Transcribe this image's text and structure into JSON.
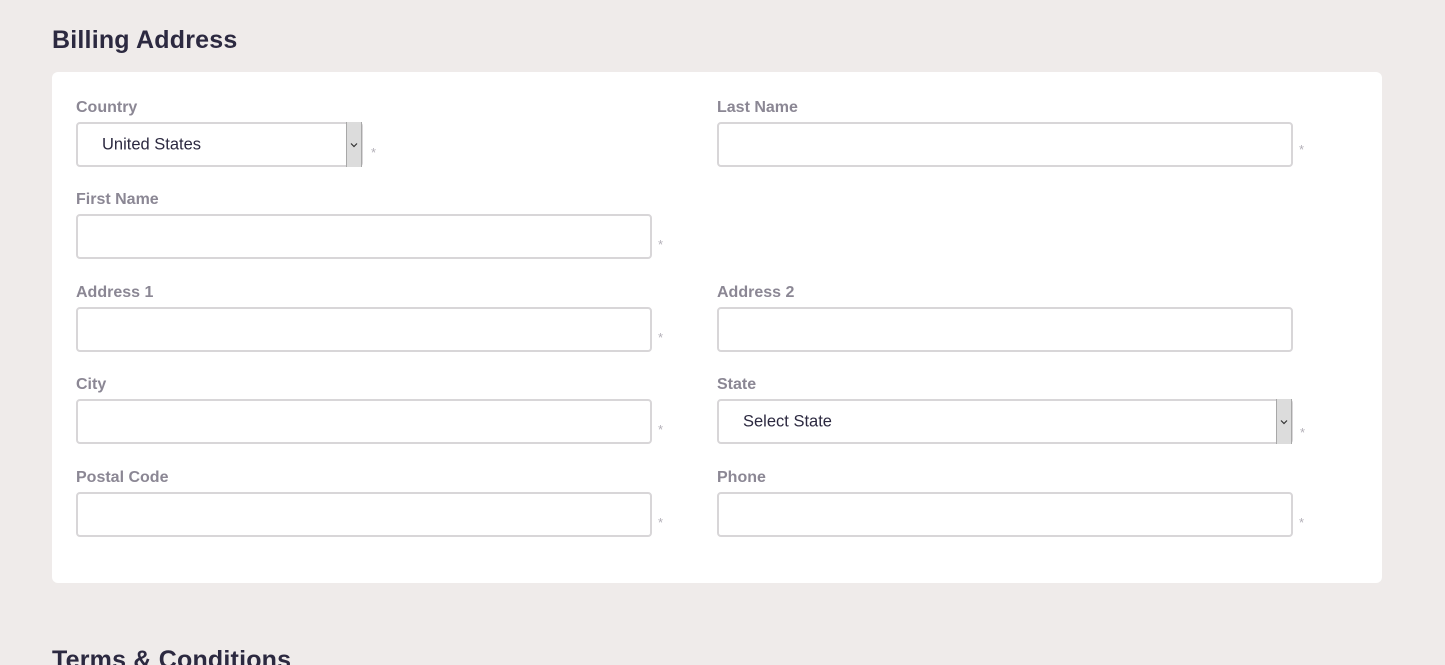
{
  "billing": {
    "title": "Billing Address",
    "fields": {
      "country": {
        "label": "Country",
        "value": "United States",
        "required_mark": "*"
      },
      "last_name": {
        "label": "Last Name",
        "value": "",
        "required_mark": "*"
      },
      "first_name": {
        "label": "First Name",
        "value": "",
        "required_mark": "*"
      },
      "address1": {
        "label": "Address 1",
        "value": "",
        "required_mark": "*"
      },
      "address2": {
        "label": "Address 2",
        "value": ""
      },
      "city": {
        "label": "City",
        "value": "",
        "required_mark": "*"
      },
      "state": {
        "label": "State",
        "value": "Select State",
        "required_mark": "*"
      },
      "postal_code": {
        "label": "Postal Code",
        "value": "",
        "required_mark": "*"
      },
      "phone": {
        "label": "Phone",
        "value": "",
        "required_mark": "*"
      }
    }
  },
  "terms": {
    "title": "Terms & Conditions"
  },
  "icons": {
    "select_arrow": "chevron-down-icon"
  },
  "colors": {
    "page_background": "#efebea",
    "card_background": "#ffffff",
    "heading": "#2c2940",
    "label": "#8b8794",
    "input_border": "#d8d6d8"
  }
}
